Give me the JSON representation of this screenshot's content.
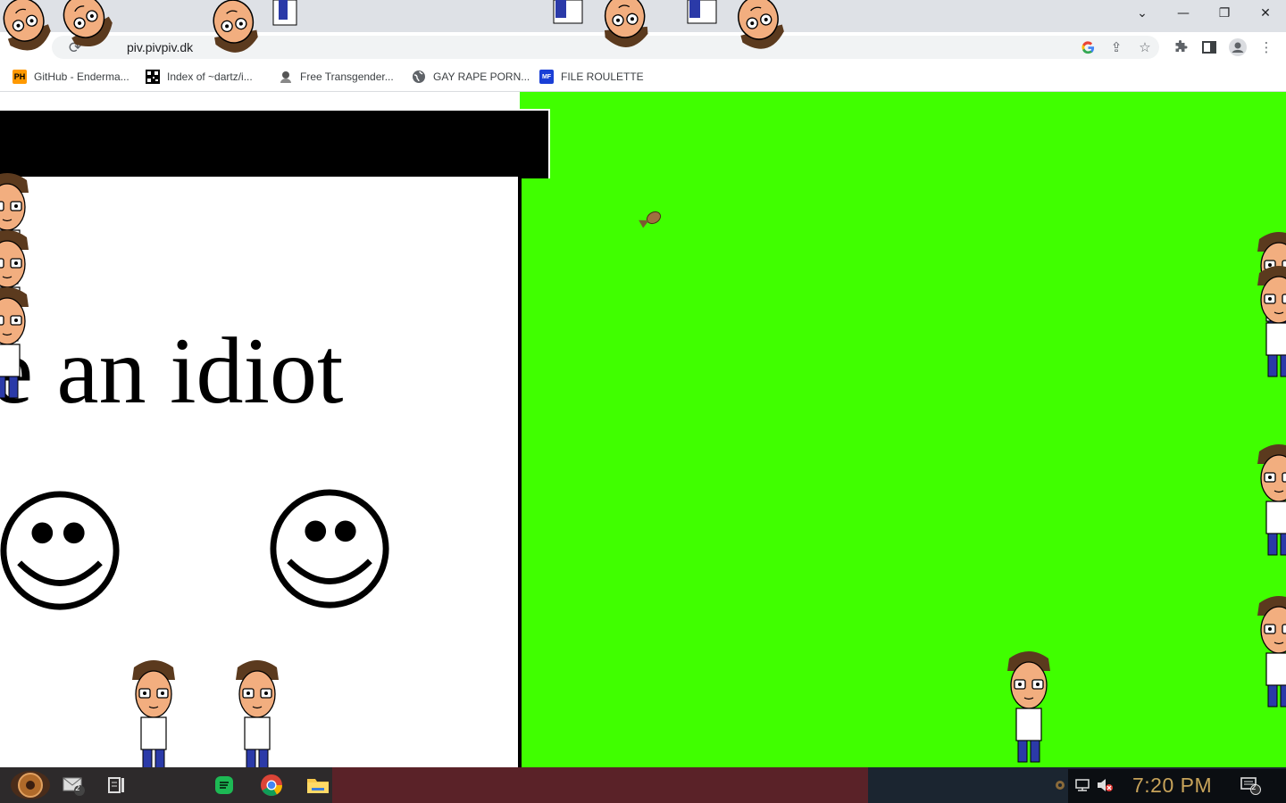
{
  "browser": {
    "url": "piv.pivpiv.dk",
    "window_controls": {
      "tab_search": "⌄",
      "minimize": "—",
      "restore": "❐",
      "close": "✕"
    },
    "bookmarks": [
      {
        "label": "GitHub - Enderma...",
        "icon": "pornhub-icon",
        "badge": "PH"
      },
      {
        "label": "Index of ~dartz/i...",
        "icon": "qr-icon",
        "badge": ""
      },
      {
        "label": "Free Transgender...",
        "icon": "bust-icon",
        "badge": ""
      },
      {
        "label": "GAY RAPE PORN...",
        "icon": "globe-icon",
        "badge": ""
      },
      {
        "label": "FILE ROULETTE",
        "icon": "mediafire-icon",
        "badge": "MF"
      }
    ]
  },
  "page": {
    "popup_text": "e an idiot",
    "background_color": "#40ff00"
  },
  "taskbar": {
    "clock": "7:20 PM",
    "notification_count": "2",
    "mail_badge": "2"
  },
  "colors": {
    "green": "#40ff00",
    "chrome_gray": "#dee1e6",
    "clock_gold": "#c7a35a"
  }
}
